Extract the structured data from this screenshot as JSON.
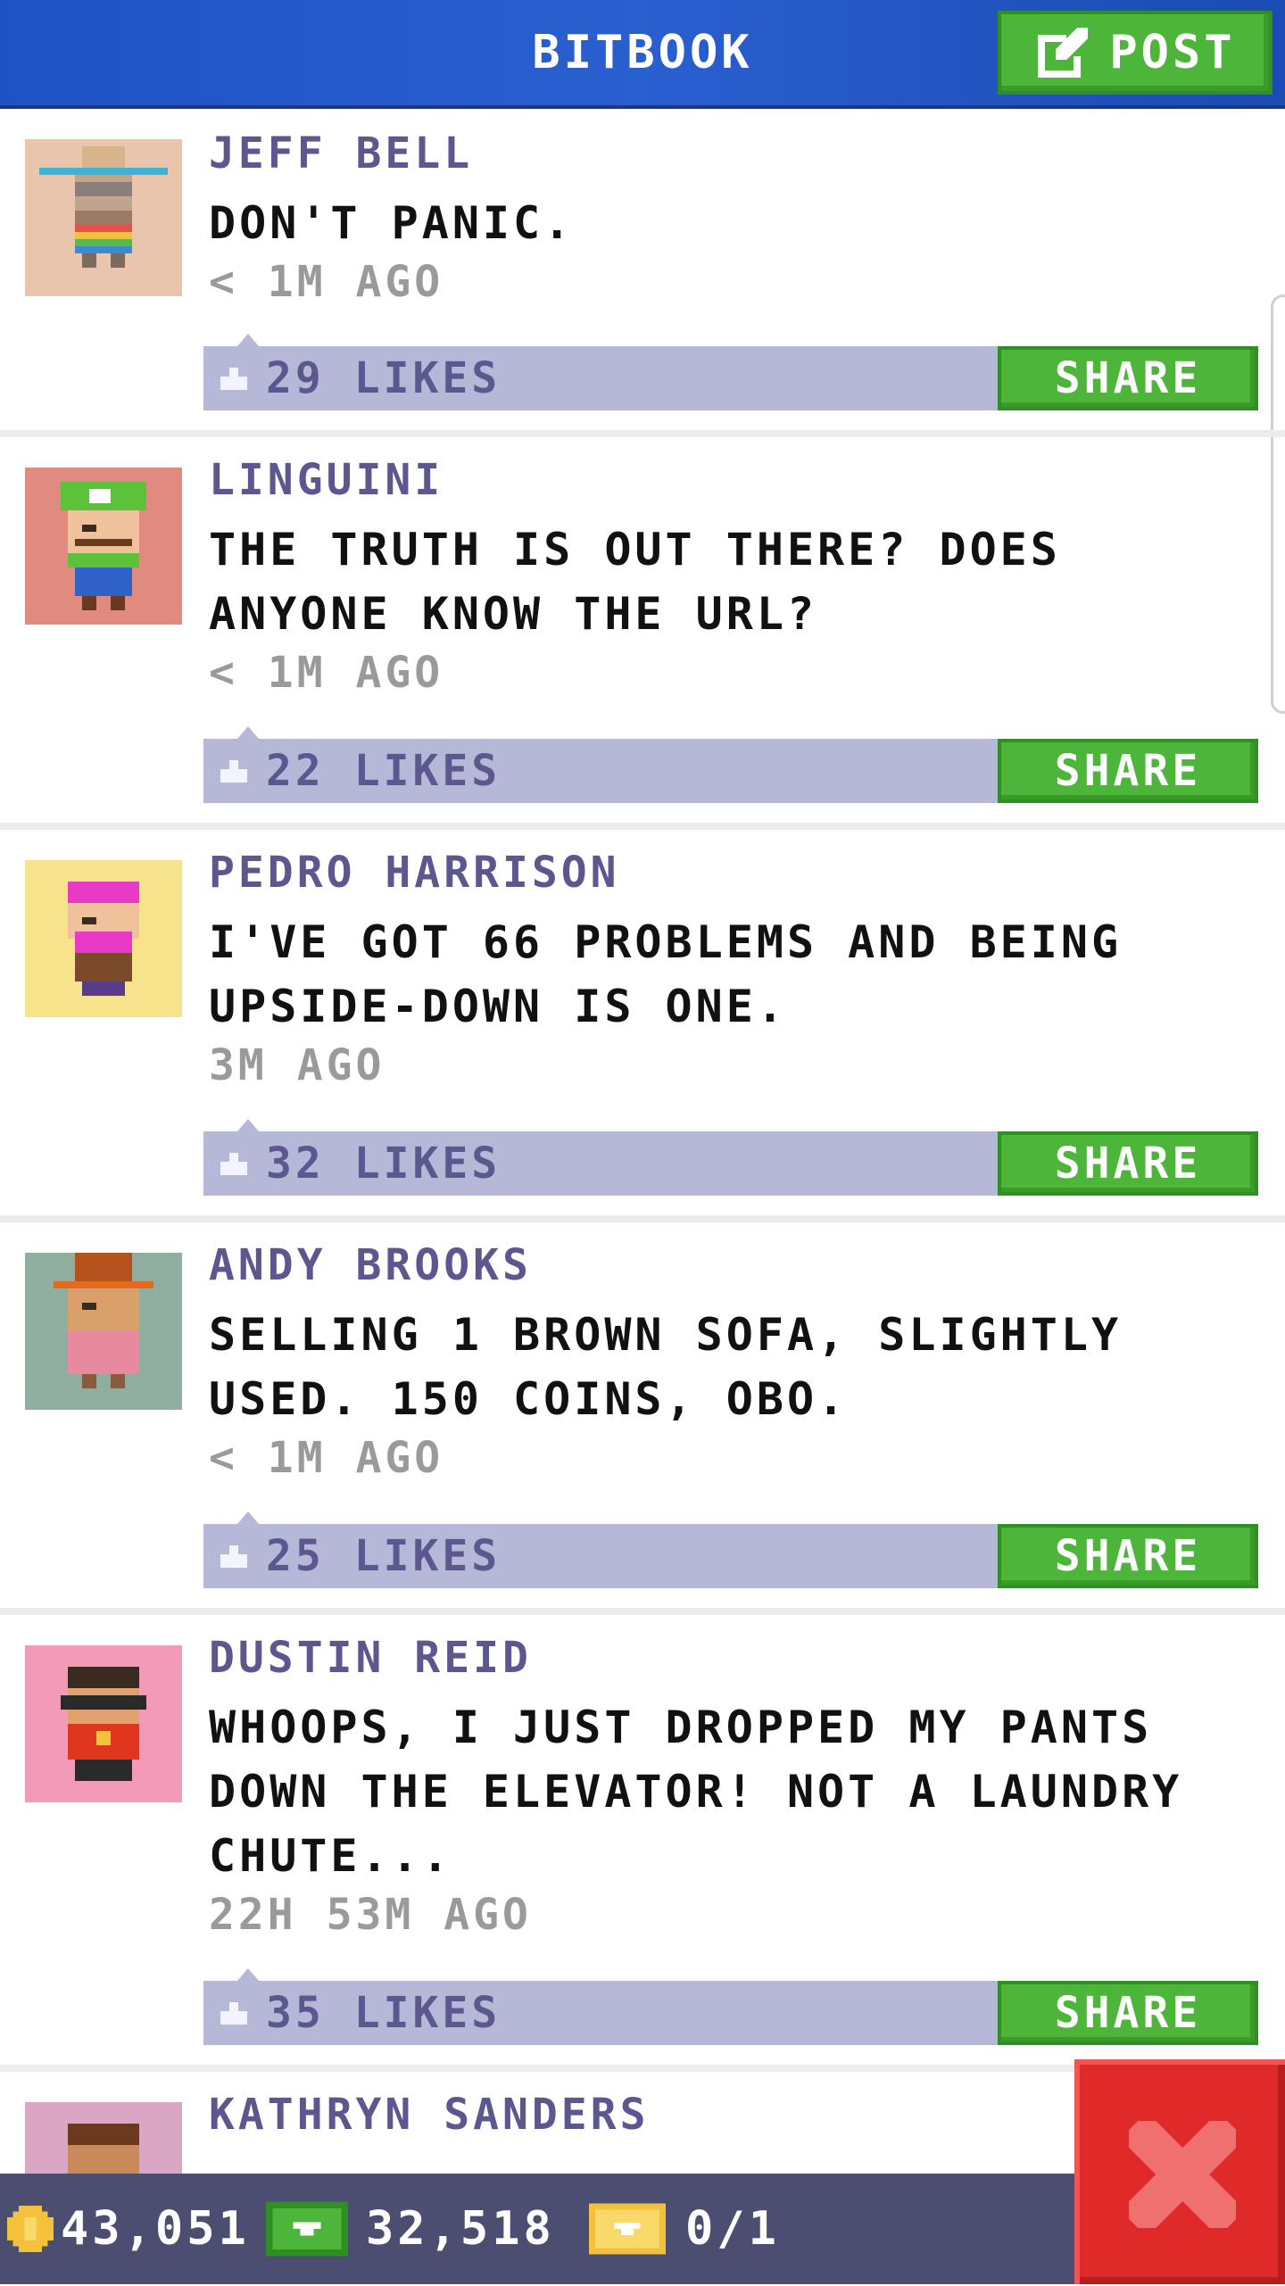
{
  "header": {
    "title": "BITBOOK",
    "post_label": "POST"
  },
  "posts": [
    {
      "author": "JEFF BELL",
      "message": "DON'T PANIC.",
      "time": "< 1M AGO",
      "likes": "29 LIKES",
      "share": "SHARE",
      "avatar_bg": "#e9c5ad"
    },
    {
      "author": "LINGUINI",
      "message": "THE TRUTH IS OUT THERE? DOES ANYONE KNOW THE URL?",
      "time": "< 1M AGO",
      "likes": "22 LIKES",
      "share": "SHARE",
      "avatar_bg": "#e08a80"
    },
    {
      "author": "PEDRO HARRISON",
      "message": "I'VE GOT 66 PROBLEMS AND BEING UPSIDE-DOWN IS ONE.",
      "time": "3M AGO",
      "likes": "32 LIKES",
      "share": "SHARE",
      "avatar_bg": "#f7e38c"
    },
    {
      "author": "ANDY BROOKS",
      "message": "SELLING 1 BROWN SOFA, SLIGHTLY USED. 150 COINS, OBO.",
      "time": "< 1M AGO",
      "likes": "25 LIKES",
      "share": "SHARE",
      "avatar_bg": "#8fae9f"
    },
    {
      "author": "DUSTIN REID",
      "message": "WHOOPS, I JUST DROPPED MY PANTS DOWN THE ELEVATOR! NOT A LAUNDRY CHUTE...",
      "time": "22H 53M AGO",
      "likes": "35 LIKES",
      "share": "SHARE",
      "avatar_bg": "#f39ab8"
    },
    {
      "author": "KATHRYN SANDERS",
      "avatar_bg": "#d9a6c4"
    }
  ],
  "status_bar": {
    "coins": "43,051",
    "bux": "32,518",
    "tickets": "0/1"
  },
  "colors": {
    "header_blue": "#2459c9",
    "green": "#4db53a",
    "likes_bar": "#b6b8d8",
    "author": "#5c578f",
    "close_red": "#e02a2a"
  }
}
